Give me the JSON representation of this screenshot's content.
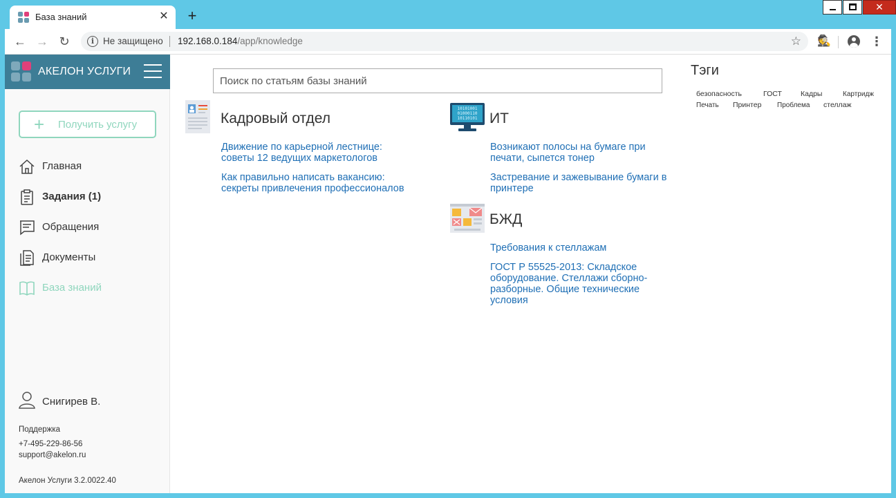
{
  "browser": {
    "tab_title": "База знаний",
    "tab_close": "✕",
    "new_tab": "+",
    "security_label": "Не защищено",
    "url_host": "192.168.0.184",
    "url_path": "/app/knowledge"
  },
  "sidebar": {
    "brand": "АКЕЛОН УСЛУГИ",
    "get_service_label": "Получить услугу",
    "items": [
      {
        "label": "Главная",
        "icon": "home-icon"
      },
      {
        "label": "Задания (1)",
        "icon": "clipboard-icon"
      },
      {
        "label": "Обращения",
        "icon": "message-icon"
      },
      {
        "label": "Документы",
        "icon": "document-icon"
      },
      {
        "label": "База знаний",
        "icon": "book-icon"
      }
    ],
    "user_name": "Снигирев В.",
    "support_title": "Поддержка",
    "support_phone": "+7-495-229-86-56",
    "support_email": "support@akelon.ru",
    "version": "Акелон Услуги 3.2.0022.40"
  },
  "main": {
    "search_placeholder": "Поиск по статьям базы знаний",
    "sections": [
      {
        "title": "Кадровый отдел",
        "icon": "hr-card-icon",
        "links": [
          "Движение по карьерной лестнице: советы 12 ведущих маркетологов",
          "Как правильно написать вакансию: секреты привлечения профессионалов"
        ]
      },
      {
        "title": "ИТ",
        "icon": "monitor-icon",
        "links": [
          "Возникают полосы на бумаге при печати, сыпется тонер",
          "Застревание и зажевывание бумаги в принтере"
        ]
      },
      {
        "title": "БЖД",
        "icon": "safety-icon",
        "links": [
          "Требования к стеллажам",
          "ГОСТ Р 55525-2013: Складское оборудование. Стеллажи сборно-разборные. Общие технические условия"
        ]
      }
    ]
  },
  "tags": {
    "title": "Тэги",
    "items": [
      "безопасность",
      "ГОСТ",
      "Кадры",
      "Картридж",
      "Печать",
      "Принтер",
      "Проблема",
      "стеллаж"
    ]
  },
  "colors": {
    "brand": "#3d7d96",
    "accent": "#8fd6bd",
    "link": "#1f6fb5",
    "window_frame": "#5fc8e6"
  }
}
